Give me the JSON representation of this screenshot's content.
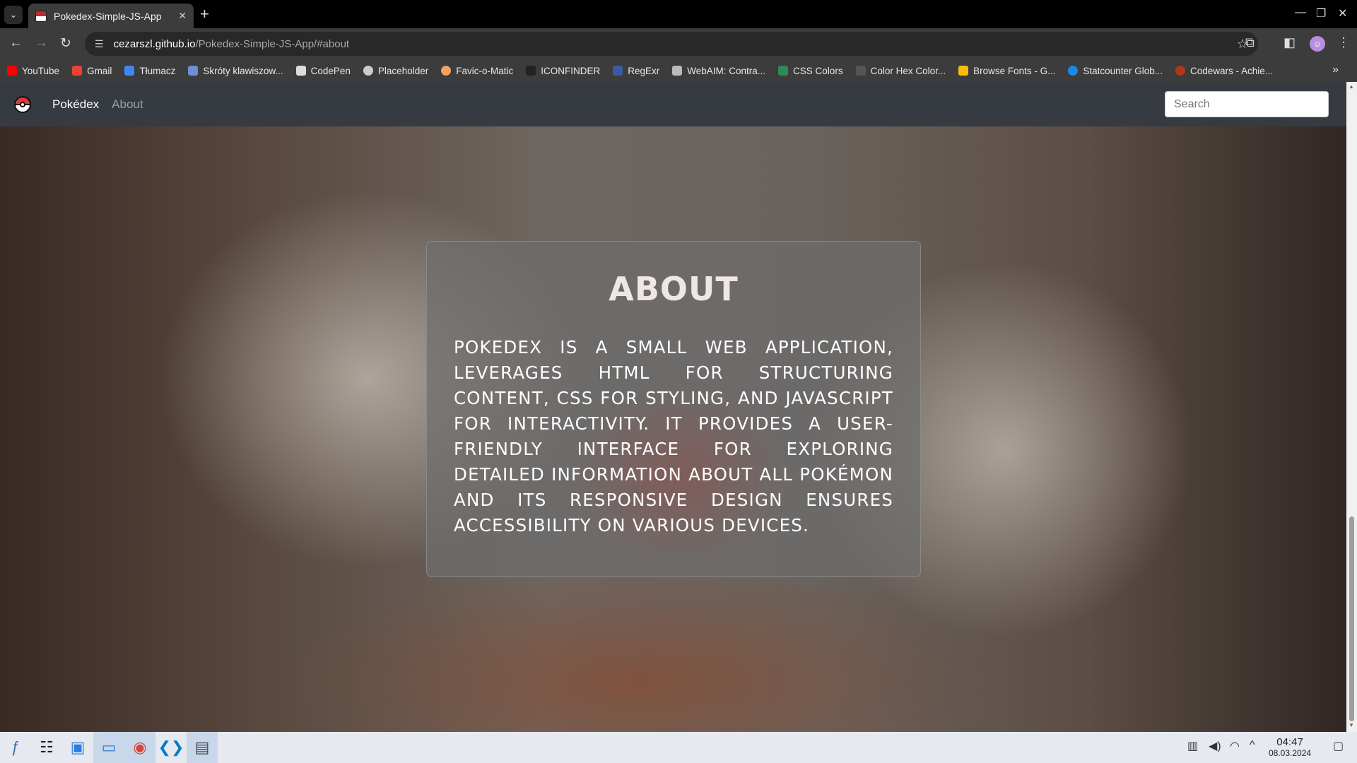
{
  "browser": {
    "tab_title": "Pokedex-Simple-JS-App",
    "tab_close": "✕",
    "new_tab": "+",
    "url_host": "cezarszl.github.io",
    "url_path": "/Pokedex-Simple-JS-App/#about",
    "bookmarks": [
      {
        "label": "YouTube",
        "color": "#ff0000"
      },
      {
        "label": "Gmail",
        "color": "#ea4335"
      },
      {
        "label": "Tłumacz",
        "color": "#4285f4"
      },
      {
        "label": "Skróty klawiszow...",
        "color": "#6c8fd6"
      },
      {
        "label": "CodePen",
        "color": "#dddddd"
      },
      {
        "label": "Placeholder",
        "color": "#cccccc"
      },
      {
        "label": "Favic-o-Matic",
        "color": "#f4a261"
      },
      {
        "label": "ICONFINDER",
        "color": "#222222"
      },
      {
        "label": "RegExr",
        "color": "#3a5ba0"
      },
      {
        "label": "WebAIM: Contra...",
        "color": "#bbbbbb"
      },
      {
        "label": "CSS Colors",
        "color": "#2e8b57"
      },
      {
        "label": "Color Hex Color...",
        "color": "#555555"
      },
      {
        "label": "Browse Fonts - G...",
        "color": "#fbbc05"
      },
      {
        "label": "Statcounter Glob...",
        "color": "#1e88e5"
      },
      {
        "label": "Codewars - Achie...",
        "color": "#b1361e"
      }
    ]
  },
  "site": {
    "brand": "Pokédex",
    "nav_about": "About",
    "search_placeholder": "Search",
    "about_title": "ABOUT",
    "about_text": "Pokedex is a small web application, leverages HTML for structuring content, CSS for styling, and JavaScript for interactivity. It provides a user-friendly interface for exploring detailed information about all Pokémon and its responsive design ensures accessibility on various devices."
  },
  "taskbar": {
    "time": "04:47",
    "date": "08.03.2024"
  }
}
